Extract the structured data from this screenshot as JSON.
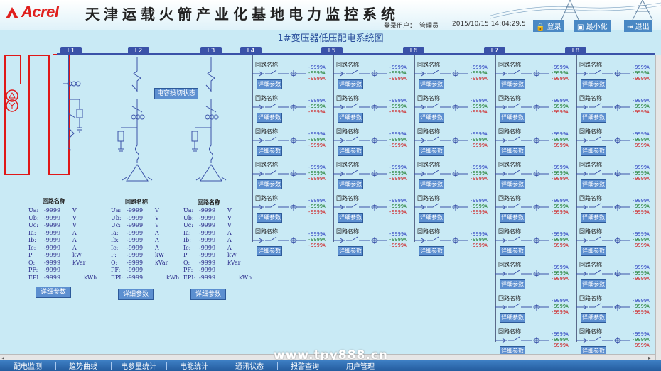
{
  "brand": {
    "logo_text": "Acrel",
    "system_title": "天津运载火箭产业化基地电力监控系统"
  },
  "userbar": {
    "login_label": "登录用户：",
    "user": "管理员",
    "datetime": "2015/10/15 14:04:29.5",
    "login_btn": "登录",
    "minimize_btn": "最小化",
    "exit_btn": "退出"
  },
  "diagram": {
    "title": "1#变压器低压配电系统图",
    "cap_switch_label": "电容投切状态",
    "lines": [
      "L1",
      "L2",
      "L3",
      "L4",
      "L5",
      "L6",
      "L7",
      "L8"
    ],
    "circuit_name": "回路名称",
    "detail_btn": "详细参数",
    "reading": "-9999",
    "reading_unit": "A"
  },
  "panels": [
    {
      "title": "回路名称",
      "rows": [
        {
          "label": "Ua:",
          "value": "-9999",
          "unit": "V"
        },
        {
          "label": "Ub:",
          "value": "-9999",
          "unit": "V"
        },
        {
          "label": "Uc:",
          "value": "-9999",
          "unit": "V"
        },
        {
          "label": "Ia:",
          "value": "-9999",
          "unit": "A"
        },
        {
          "label": "Ib:",
          "value": "-9999",
          "unit": "A"
        },
        {
          "label": "Ic:",
          "value": "-9999",
          "unit": "A"
        },
        {
          "label": "P:",
          "value": "-9999",
          "unit": "kW"
        },
        {
          "label": "Q:",
          "value": "-9999",
          "unit": "kVar"
        },
        {
          "label": "PF:",
          "value": "-9999",
          "unit": ""
        },
        {
          "label": "EPI",
          "value": "-9999",
          "unit": "kWh"
        }
      ],
      "btn": "详细参数"
    },
    {
      "title": "回路名称",
      "rows": [
        {
          "label": "Ua:",
          "value": "-9999",
          "unit": "V"
        },
        {
          "label": "Ub:",
          "value": "-9999",
          "unit": "V"
        },
        {
          "label": "Uc:",
          "value": "-9999",
          "unit": "V"
        },
        {
          "label": "Ia:",
          "value": "-9999",
          "unit": "A"
        },
        {
          "label": "Ib:",
          "value": "-9999",
          "unit": "A"
        },
        {
          "label": "Ic:",
          "value": "-9999",
          "unit": "A"
        },
        {
          "label": "P:",
          "value": "-9999",
          "unit": "kW"
        },
        {
          "label": "Q:",
          "value": "-9999",
          "unit": "kVar"
        },
        {
          "label": "PF:",
          "value": "-9999",
          "unit": ""
        },
        {
          "label": "EPI:",
          "value": "-9999",
          "unit": "kWh"
        }
      ],
      "btn": "详细参数"
    },
    {
      "title": "回路名称",
      "rows": [
        {
          "label": "Ua:",
          "value": "-9999",
          "unit": "V"
        },
        {
          "label": "Ub:",
          "value": "-9999",
          "unit": "V"
        },
        {
          "label": "Uc:",
          "value": "-9999",
          "unit": "V"
        },
        {
          "label": "Ia:",
          "value": "-9999",
          "unit": "A"
        },
        {
          "label": "Ib:",
          "value": "-9999",
          "unit": "A"
        },
        {
          "label": "Ic:",
          "value": "-9999",
          "unit": "A"
        },
        {
          "label": "P:",
          "value": "-9999",
          "unit": "kW"
        },
        {
          "label": "Q:",
          "value": "-9999",
          "unit": "kVar"
        },
        {
          "label": "PF:",
          "value": "-9999",
          "unit": ""
        },
        {
          "label": "EPI:",
          "value": "-9999",
          "unit": "kWh"
        }
      ],
      "btn": "详细参数"
    }
  ],
  "watermark": "www.tpy888.cn",
  "nav": [
    "配电监测",
    "趋势曲线",
    "电参量统计",
    "电能统计",
    "通讯状态",
    "报警查询",
    "用户管理"
  ],
  "colors": {
    "bus": "#3a52a8",
    "source": "#e01818",
    "button": "#5c8fd0",
    "nav": "#2e6db2"
  }
}
